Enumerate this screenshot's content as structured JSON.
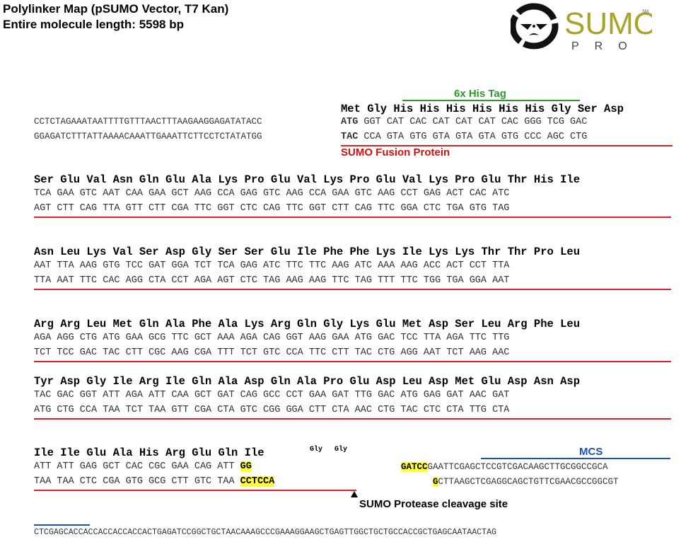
{
  "header": {
    "title_line1": "Polylinker Map (pSUMO Vector, T7 Kan)",
    "title_line2": "Entire molecule length: 5598 bp"
  },
  "logo": {
    "brand": "SUMO",
    "sub": "PRO",
    "mark": "SM",
    "colors": {
      "brand": "#a8a32a",
      "icon": "#111111"
    }
  },
  "labels": {
    "his_tag": "6x His Tag",
    "fusion": "SUMO Fusion Protein",
    "mcs": "MCS",
    "cleavage": "SUMO Protease cleavage site",
    "gly1": "Gly",
    "gly2": "Gly"
  },
  "block1": {
    "leader_top": "CCTCTAGAAATAATTTTGTTTAACTTTAAGAAGGAGATATACC",
    "leader_bot": "GGAGATCTTTATTAAAACAAATTGAAATTCTTCCTCTATATGG",
    "aa": "Met Gly His His His His His His Gly Ser Asp",
    "top_start": "ATG",
    "top_rest": " GGT CAT CAC CAT CAT CAT CAC GGG TCG GAC",
    "bot_start": "TAC",
    "bot_rest": " CCA GTA GTG GTA GTA GTA GTG CCC AGC CTG"
  },
  "rows": [
    {
      "aa": "Ser Glu Val Asn Gln Glu Ala Lys Pro Glu Val Lys Pro Glu Val Lys Pro Glu Thr His Ile",
      "top": "TCA GAA GTC AAT CAA GAA GCT AAG CCA GAG GTC AAG CCA GAA GTC AAG CCT GAG ACT CAC ATC",
      "bot": "AGT CTT CAG TTA GTT CTT CGA TTC GGT CTC CAG TTC GGT CTT CAG TTC GGA CTC TGA GTG TAG"
    },
    {
      "aa": "Asn Leu Lys Val Ser Asp Gly Ser Ser Glu Ile Phe Phe Lys Ile Lys Lys Thr Thr Pro Leu",
      "top": "AAT TTA AAG GTG TCC GAT GGA TCT TCA GAG ATC TTC TTC AAG ATC AAA AAG ACC ACT CCT TTA",
      "bot": "TTA AAT TTC CAC AGG CTA CCT AGA AGT CTC TAG AAG AAG TTC TAG TTT TTC TGG TGA GGA AAT"
    },
    {
      "aa": "Arg Arg Leu Met Gln Ala Phe Ala Lys Arg Gln Gly Lys Glu Met Asp Ser Leu Arg Phe Leu",
      "top": "AGA AGG CTG ATG GAA GCG TTC GCT AAA AGA CAG GGT AAG GAA ATG GAC TCC TTA AGA TTC TTG",
      "bot": "TCT TCC GAC TAC CTT CGC AAG CGA TTT TCT GTC CCA TTC CTT TAC CTG AGG AAT TCT AAG AAC"
    },
    {
      "aa": "Tyr Asp Gly Ile Arg Ile Gln Ala Asp Gln Ala Pro Glu Asp Leu Asp Met Glu Asp Asn Asp",
      "top": "TAC GAC GGT ATT AGA ATT CAA GCT GAT CAG GCC CCT GAA GAT TTG GAC ATG GAG GAT AAC GAT",
      "bot": "ATG CTG CCA TAA TCT TAA GTT CGA CTA GTC CGG GGA CTT CTA AAC CTG TAC CTC CTA TTG CTA"
    }
  ],
  "final_block": {
    "aa": "Ile Ile Glu Ala His Arg Glu Gln Ile",
    "top": "ATT ATT GAG GCT CAC CGC GAA CAG ATT ",
    "top_hl": "GG",
    "bot": "TAA TAA CTC CGA GTG GCG CTT GTC TAA ",
    "bot_hl": "CCTCCA",
    "right_top_hl": "GATCC",
    "right_top": "GAATTCGAGCTCCGTCGACAAGCTTGCGGCCGCA",
    "right_bot_hl": "G",
    "right_bot": "CTTAAGCTCGAGGCAGCTGTTCGAACGCCGGCGT"
  },
  "bottom_seq": "CTCGAGCACCACCACCACCACCACTGAGATCCGGCTGCTAACAAAGCCCGAAAGGAAGCTGAGTTGGCTGCTGCCACCGCTGAGCAATAACTAG"
}
